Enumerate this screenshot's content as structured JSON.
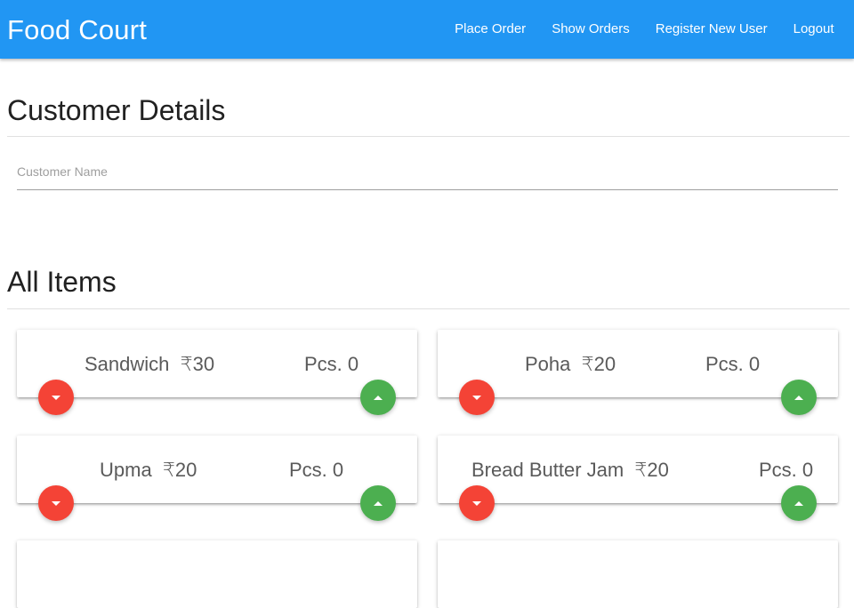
{
  "app": {
    "title": "Food Court"
  },
  "nav": {
    "items": [
      {
        "label": "Place Order"
      },
      {
        "label": "Show Orders"
      },
      {
        "label": "Register New User"
      },
      {
        "label": "Logout"
      }
    ]
  },
  "customer": {
    "heading": "Customer Details",
    "name_placeholder": "Customer Name",
    "name_value": ""
  },
  "items_section": {
    "heading": "All Items",
    "items": [
      {
        "name": "Sandwich",
        "price": "₹30",
        "qty_label": "Pcs. 0"
      },
      {
        "name": "Poha",
        "price": "₹20",
        "qty_label": "Pcs. 0"
      },
      {
        "name": "Upma",
        "price": "₹20",
        "qty_label": "Pcs. 0"
      },
      {
        "name": "Bread Butter Jam",
        "price": "₹20",
        "qty_label": "Pcs. 0"
      }
    ]
  },
  "colors": {
    "primary": "#2196f3",
    "decrement": "#f44336",
    "increment": "#4caf50"
  },
  "icons": {
    "decrement": "arrow-drop-down-icon",
    "increment": "arrow-drop-up-icon"
  }
}
